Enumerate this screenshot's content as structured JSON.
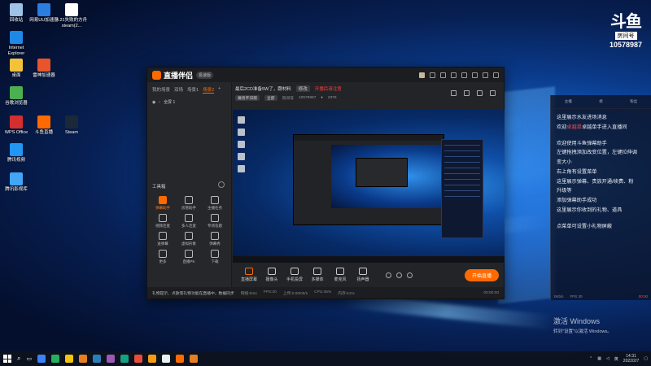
{
  "desktop": {
    "icons": [
      {
        "label": "回收站",
        "color": "#9ec3e6"
      },
      {
        "label": "网易UU加速器",
        "color": "#2b7de0"
      },
      {
        "label": "4.21失败的方舟steam(2...",
        "color": "#ffffff"
      },
      {
        "label": "Internet Explorer",
        "color": "#1e88e5"
      },
      {
        "label": "桌面",
        "color": "#f3c23a"
      },
      {
        "label": "雷神加速器",
        "color": "#e8552a"
      },
      {
        "label": "谷歌浏览器",
        "color": "#4caf50"
      },
      {
        "label": "WPS Office",
        "color": "#d32f2f"
      },
      {
        "label": "斗鱼直播",
        "color": "#ff6a00"
      },
      {
        "label": "Steam",
        "color": "#1b2838"
      },
      {
        "label": "腾讯视频",
        "color": "#2196f3"
      },
      {
        "label": "腾讯影视库",
        "color": "#42a5f5"
      }
    ]
  },
  "badge": {
    "logo": "斗鱼",
    "room_label": "房间号",
    "room_number": "10578987"
  },
  "app": {
    "name": "直播伴侣",
    "version": "极速版",
    "scene_tabs": [
      "我的场景",
      "双场",
      "场景1",
      "场景2"
    ],
    "active_tab_index": 3,
    "scene_item": "全屏 1",
    "tools_title": "工具箱",
    "tools": [
      {
        "label": "弹幕助手",
        "hot": true
      },
      {
        "label": "房管助手",
        "hot": false
      },
      {
        "label": "主播任务",
        "hot": false
      },
      {
        "label": "视频连麦",
        "hot": false
      },
      {
        "label": "多人连麦",
        "hot": false
      },
      {
        "label": "专场答题",
        "hot": false
      },
      {
        "label": "送弹幕",
        "hot": false
      },
      {
        "label": "虚拟形象",
        "hot": false
      },
      {
        "label": "弹幕秀",
        "hot": false
      },
      {
        "label": "更多",
        "hot": false
      },
      {
        "label": "直播PK",
        "hot": false
      },
      {
        "label": "下载",
        "hot": false
      }
    ],
    "room_title": "最后2CD准备5W了，跟材料",
    "room_tag": "修改",
    "live_status": "开播后请注意",
    "category": "魔兽怀旧服",
    "sub_category": "全部",
    "room_no_label": "房间号",
    "room_no": "10578987",
    "heat": "2375",
    "bottom_buttons": [
      "直播屏幕",
      "摄像头",
      "手机投屏",
      "多媒体",
      "麦克风",
      "扬声器"
    ],
    "go_live": "开始直播",
    "status_warn": "礼物提示、点歌等礼物功能在直播中，数据同步",
    "status_items": [
      "网络:0ms",
      "FPS:30",
      "上传:0.00KB/s",
      "CPU:45%",
      "内存:51%"
    ],
    "timer": "00:00:00"
  },
  "chat": {
    "header": [
      "主播",
      "榜",
      "粉丝"
    ],
    "messages": [
      "这里展示水友进场消息",
      "欢迎",
      "卓越单手进入直播间",
      "",
      "欢迎使用斗鱼弹幕助手",
      "左键拖拽添加改变位置，左键拉伸调",
      "变大小",
      "右上角有设置菜单",
      "这里展示弹幕、贵族开通/续费、粉",
      "升级等",
      "添加弹幕助手成功",
      "这里展示你收到的礼物、道具",
      "",
      "点菜单可设置小礼物屏蔽"
    ],
    "highlight_name": "卓越单",
    "footer": [
      "0Kb/s",
      "FPS 30",
      "00:00"
    ]
  },
  "activate": {
    "title": "激活 Windows",
    "sub": "转到\"设置\"以激活 Windows。"
  },
  "taskbar": {
    "apps": [
      "#3b82f6",
      "#27ae60",
      "#f1c40f",
      "#e67e22",
      "#2980b9",
      "#9b59b6",
      "#16a085",
      "#e74c3c",
      "#f39c12",
      "#ecf0f1",
      "#ff6a00",
      "#e67e22"
    ],
    "time": "14:31",
    "date": "2022/2/7",
    "tray_text": "英"
  }
}
